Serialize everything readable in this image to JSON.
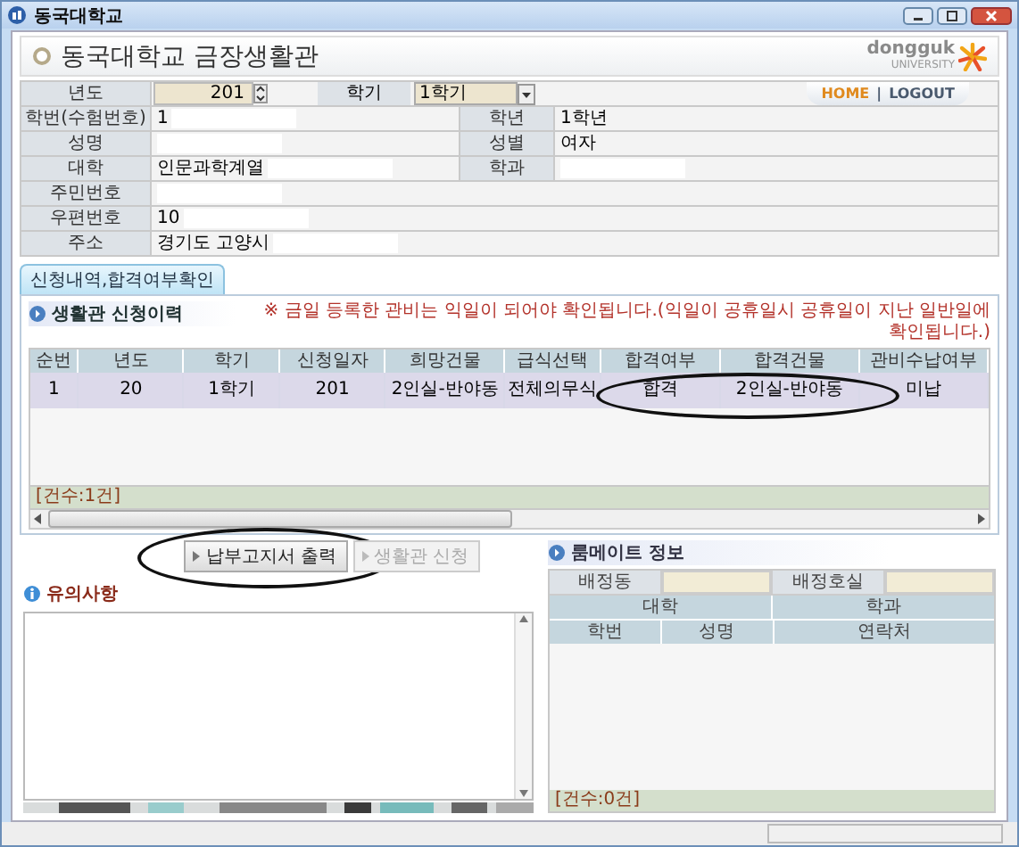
{
  "window": {
    "title": "동국대학교"
  },
  "header": {
    "title": "동국대학교 금장생활관",
    "logo_text": "dongguk",
    "logo_sub": "UNIVERSITY",
    "links": [
      "HOME",
      "LOGOUT"
    ],
    "link_separator": "|"
  },
  "filters": {
    "year_label": "년도",
    "year_value": "201",
    "term_label": "학기",
    "term_value": "1학기"
  },
  "student": [
    {
      "label": "학번(수험번호)",
      "value": "1",
      "label2": "학년",
      "value2": "1학년"
    },
    {
      "label": "성명",
      "label2": "성별",
      "value2": "여자"
    },
    {
      "label": "대학",
      "value": "인문과학계열",
      "label2": "학과"
    },
    {
      "label": "주민번호"
    },
    {
      "label": "우편번호",
      "value": "10"
    },
    {
      "label": "주소",
      "value": "경기도 고양시"
    }
  ],
  "tabs": [
    {
      "label": "신청내역,합격여부확인",
      "selected": true
    }
  ],
  "history": {
    "title": "생활관 신청이력",
    "notice": "※ 금일 등록한 관비는 익일이 되어야 확인됩니다.(익일이 공휴일시 공휴일이 지난 일반일에 확인됩니다.)",
    "columns": [
      {
        "label": "순번"
      },
      {
        "label": "년도"
      },
      {
        "label": "학기"
      },
      {
        "label": "신청일자"
      },
      {
        "label": "희망건물"
      },
      {
        "label": "급식선택"
      },
      {
        "label": "합격여부",
        "circled": true
      },
      {
        "label": "합격건물",
        "circled": true
      },
      {
        "label": "관비수납여부"
      }
    ],
    "rows": [
      {
        "selected": true,
        "cells": [
          "1",
          "20",
          "1학기",
          "201",
          "2인실-반야동",
          "전체의무식",
          "합격",
          "2인실-반야동",
          "미납"
        ]
      }
    ],
    "count": "[건수:1건]"
  },
  "buttons": [
    {
      "label": "납부고지서 출력",
      "disabled": false,
      "circled": true
    },
    {
      "label": "생활관 신청",
      "disabled": true,
      "circled": false
    }
  ],
  "notes": {
    "title": "유의사항"
  },
  "roommate": {
    "title": "룸메이트 정보",
    "assign_labels": [
      "배정동",
      "배정호실"
    ],
    "row1": [
      "대학",
      "학과"
    ],
    "row2": [
      "학번",
      "성명",
      "연락처"
    ],
    "count": "[건수:0건]"
  }
}
